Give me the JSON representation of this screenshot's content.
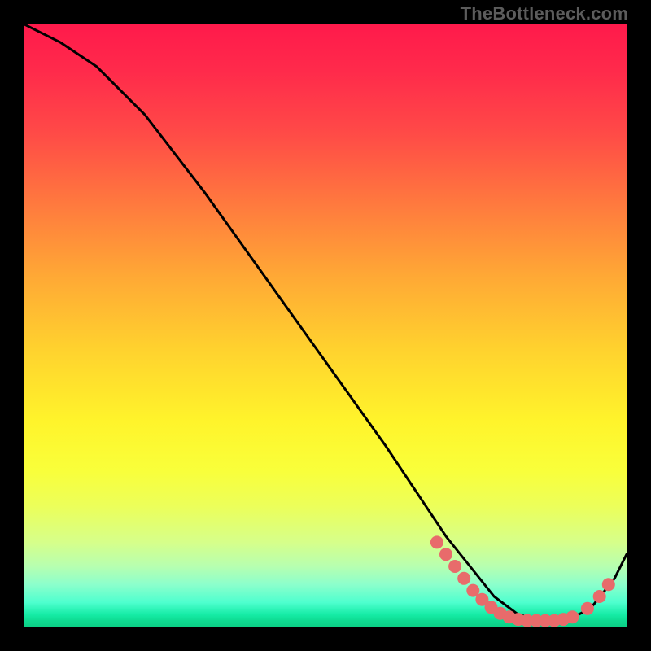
{
  "watermark": "TheBottleneck.com",
  "chart_data": {
    "type": "line",
    "title": "",
    "xlabel": "",
    "ylabel": "",
    "xlim": [
      0,
      100
    ],
    "ylim": [
      0,
      100
    ],
    "grid": false,
    "series": [
      {
        "name": "curve",
        "color": "#000000",
        "x": [
          0,
          6,
          12,
          20,
          30,
          40,
          50,
          60,
          66,
          70,
          74,
          78,
          82,
          86,
          90,
          94,
          98,
          100
        ],
        "y": [
          100,
          97,
          93,
          85,
          72,
          58,
          44,
          30,
          21,
          15,
          10,
          5,
          2,
          1,
          1,
          3,
          8,
          12
        ]
      }
    ],
    "markers": [
      {
        "name": "dots",
        "color": "#e86b6b",
        "radius": 8,
        "points": [
          {
            "x": 68.5,
            "y": 14.0
          },
          {
            "x": 70.0,
            "y": 12.0
          },
          {
            "x": 71.5,
            "y": 10.0
          },
          {
            "x": 73.0,
            "y": 8.0
          },
          {
            "x": 74.5,
            "y": 6.0
          },
          {
            "x": 76.0,
            "y": 4.5
          },
          {
            "x": 77.5,
            "y": 3.2
          },
          {
            "x": 79.0,
            "y": 2.2
          },
          {
            "x": 80.5,
            "y": 1.6
          },
          {
            "x": 82.0,
            "y": 1.2
          },
          {
            "x": 83.5,
            "y": 1.0
          },
          {
            "x": 85.0,
            "y": 1.0
          },
          {
            "x": 86.5,
            "y": 1.0
          },
          {
            "x": 88.0,
            "y": 1.0
          },
          {
            "x": 89.5,
            "y": 1.2
          },
          {
            "x": 91.0,
            "y": 1.6
          },
          {
            "x": 93.5,
            "y": 3.0
          },
          {
            "x": 95.5,
            "y": 5.0
          },
          {
            "x": 97.0,
            "y": 7.0
          }
        ]
      }
    ]
  }
}
